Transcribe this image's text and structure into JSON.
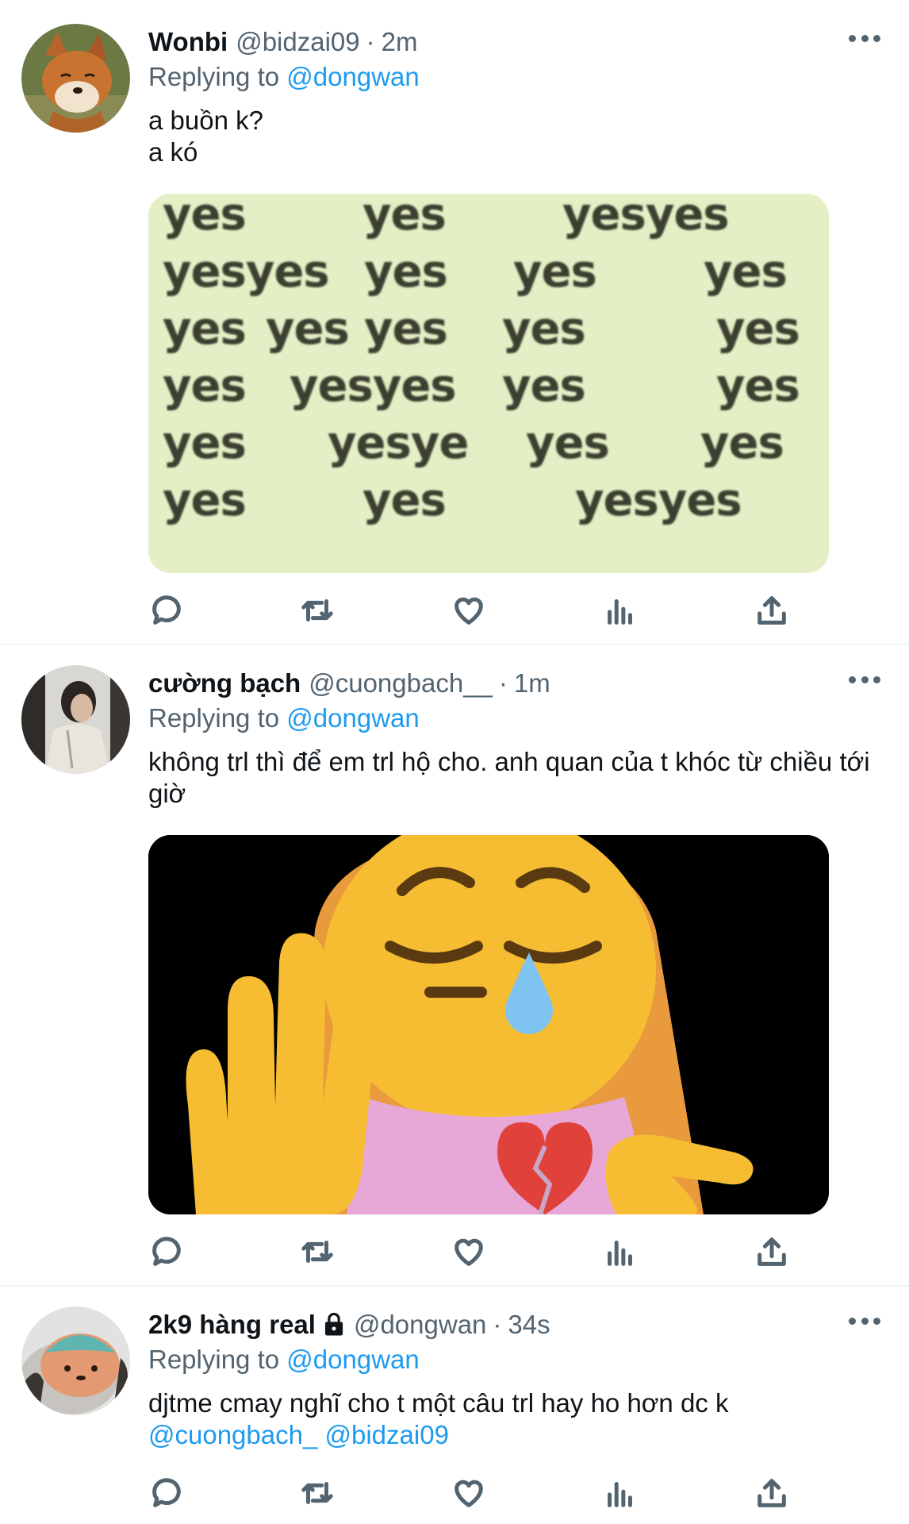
{
  "tweets": [
    {
      "name": "Wonbi",
      "handle": "@bidzai09",
      "time": "2m",
      "replying_prefix": "Replying to",
      "replying_to": "@dongwan",
      "text_lines": [
        "a buồn k?",
        "a kó"
      ],
      "media": "yes-grid-image",
      "avatar_icon": "fox-avatar"
    },
    {
      "name": "cường bạch",
      "handle": "@cuongbach__",
      "time": "1m",
      "replying_prefix": "Replying to",
      "replying_to": "@dongwan",
      "text": "không trl thì để em trl hộ cho. anh quan của t khóc từ chiều tới giờ",
      "media": "sad-emoji-image",
      "avatar_icon": "person-avatar"
    },
    {
      "name": "2k9 hàng real",
      "handle": "@dongwan",
      "time": "34s",
      "replying_prefix": "Replying to",
      "replying_to": "@dongwan",
      "text_before": "djtme cmay nghĩ cho t một câu trl hay ho hơn dc k",
      "mentions": [
        "@cuongbach_",
        "@bidzai09"
      ],
      "protected_icon": "lock-icon",
      "avatar_icon": "plush-avatar"
    }
  ],
  "separator": "·",
  "yes_grid": [
    [
      "yes",
      "yes",
      "yesyes"
    ],
    [
      "yesyes",
      "yes",
      "yes",
      "yes"
    ],
    [
      "yes",
      "yes",
      "yes",
      "yes",
      "yes"
    ],
    [
      "yes",
      "yesyes",
      "yes",
      "yes"
    ],
    [
      "yes",
      "yesye",
      "yes",
      "yes"
    ],
    [
      "yes",
      "yes",
      "yesyes"
    ]
  ],
  "action_icons": [
    "reply-icon",
    "retweet-icon",
    "like-icon",
    "analytics-icon",
    "share-icon"
  ],
  "colors": {
    "text": "#0f1419",
    "secondary": "#536471",
    "link": "#1d9bf0",
    "divider": "#eff3f4"
  }
}
